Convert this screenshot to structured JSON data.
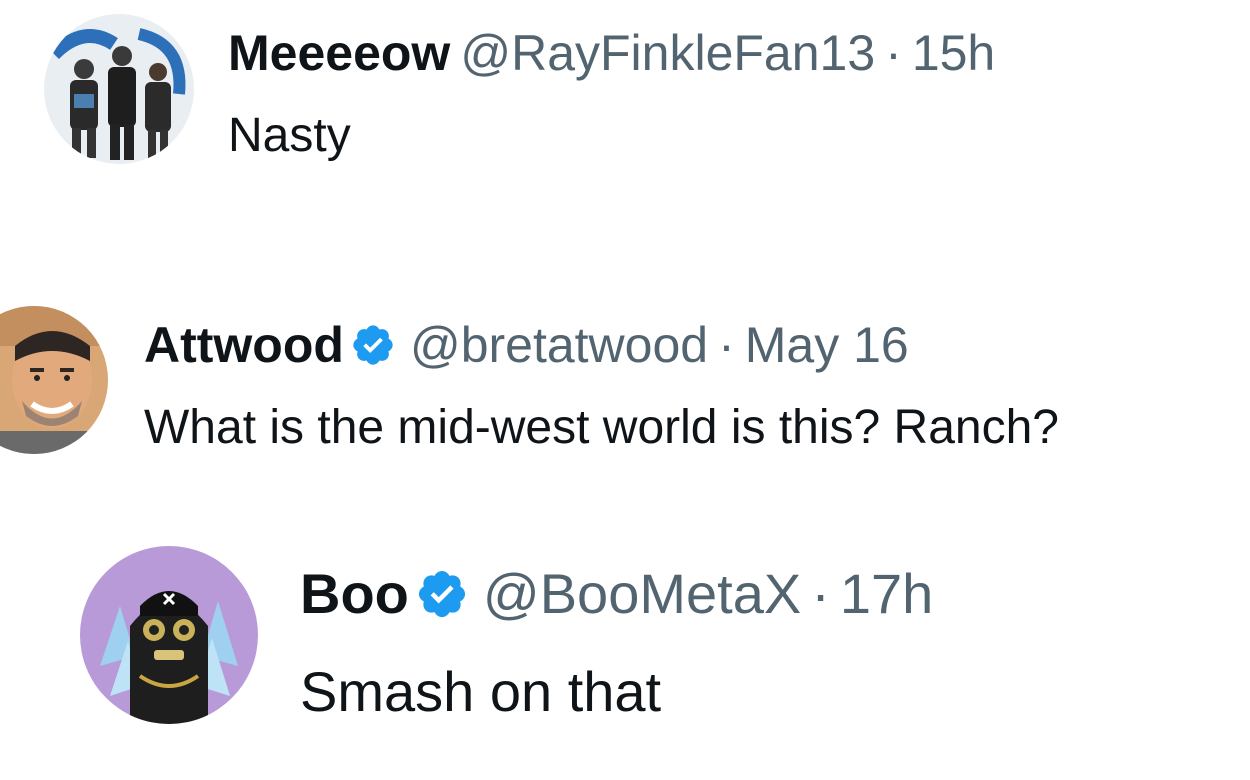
{
  "accent_color": "#1d9bf0",
  "text_color": "#0f1419",
  "muted_color": "#536471",
  "replies": [
    {
      "name": "Meeeeow",
      "verified": false,
      "handle": "@RayFinkleFan13",
      "separator": "·",
      "time": "15h",
      "text": "Nasty",
      "avatar_icon": "band-photo-avatar"
    },
    {
      "name": "Attwood",
      "verified": true,
      "handle": "@bretatwood",
      "separator": "·",
      "time": "May 16",
      "text": "What is the mid-west world is this? Ranch?",
      "avatar_icon": "cartoon-man-avatar"
    },
    {
      "name": "Boo",
      "verified": true,
      "handle": "@BooMetaX",
      "separator": "·",
      "time": "17h",
      "text": "Smash on that",
      "avatar_icon": "nft-ghost-avatar"
    }
  ]
}
